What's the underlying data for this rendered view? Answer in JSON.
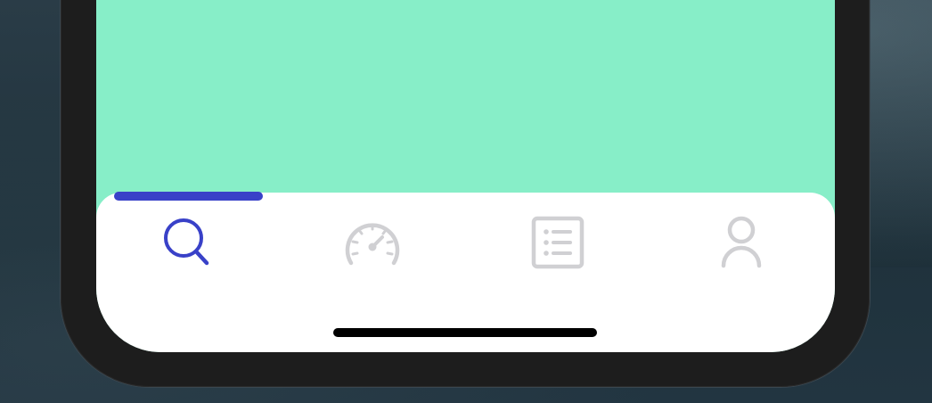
{
  "colors": {
    "screen_background": "#87eec8",
    "tab_bar_background": "#ffffff",
    "active_accent": "#3941c8",
    "inactive_icon": "#d0d0d3",
    "phone_bezel": "#1d1d1d",
    "home_indicator": "#000000"
  },
  "tab_bar": {
    "active_index": 0,
    "tabs": [
      {
        "icon": "search-icon",
        "active": true
      },
      {
        "icon": "speedometer-icon",
        "active": false
      },
      {
        "icon": "list-icon",
        "active": false
      },
      {
        "icon": "user-icon",
        "active": false
      }
    ]
  }
}
